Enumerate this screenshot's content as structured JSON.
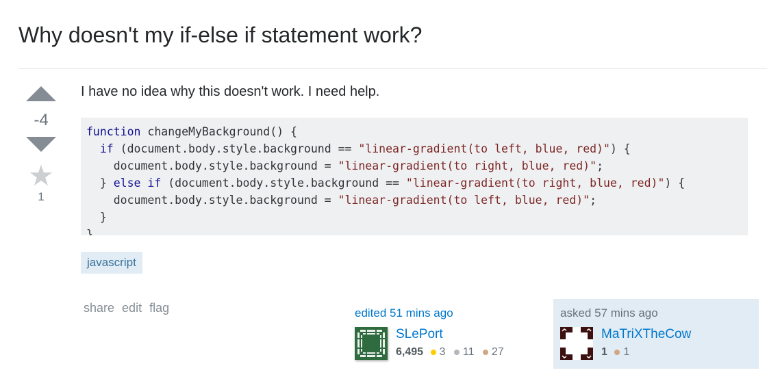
{
  "question": {
    "title": "Why doesn't my if-else if statement work?",
    "body_text": "I have no idea why this doesn't work. I need help.",
    "code_lines": [
      [
        {
          "t": "kw",
          "v": "function"
        },
        {
          "t": "p",
          "v": " changeMyBackground() {"
        }
      ],
      [
        {
          "t": "p",
          "v": "  "
        },
        {
          "t": "kw",
          "v": "if"
        },
        {
          "t": "p",
          "v": " (document.body.style.background == "
        },
        {
          "t": "str",
          "v": "\"linear-gradient(to left, blue, red)\""
        },
        {
          "t": "p",
          "v": ") {"
        }
      ],
      [
        {
          "t": "p",
          "v": "    document.body.style.background = "
        },
        {
          "t": "str",
          "v": "\"linear-gradient(to right, blue, red)\""
        },
        {
          "t": "p",
          "v": ";"
        }
      ],
      [
        {
          "t": "p",
          "v": "  } "
        },
        {
          "t": "kw",
          "v": "else if"
        },
        {
          "t": "p",
          "v": " (document.body.style.background == "
        },
        {
          "t": "str",
          "v": "\"linear-gradient(to right, blue, red)\""
        },
        {
          "t": "p",
          "v": ") {"
        }
      ],
      [
        {
          "t": "p",
          "v": "    document.body.style.background = "
        },
        {
          "t": "str",
          "v": "\"linear-gradient(to left, blue, red)\""
        },
        {
          "t": "p",
          "v": ";"
        }
      ],
      [
        {
          "t": "p",
          "v": "  }"
        }
      ],
      [
        {
          "t": "p",
          "v": "}"
        }
      ]
    ],
    "tags": [
      "javascript"
    ]
  },
  "votes": {
    "score": "-4",
    "favorites": "1",
    "icons": {
      "up": "upvote-arrow-icon",
      "down": "downvote-arrow-icon",
      "favorite": "star-icon"
    }
  },
  "post_menu": {
    "share": "share",
    "edit": "edit",
    "flag": "flag"
  },
  "editor": {
    "action": "edited 51 mins ago",
    "name": "SLePort",
    "reputation": "6,495",
    "gold": "3",
    "silver": "11",
    "bronze": "27"
  },
  "asker": {
    "action": "asked 57 mins ago",
    "name": "MaTriXTheCow",
    "reputation": "1",
    "bronze": "1"
  },
  "colors": {
    "link": "#0077cc",
    "tag_bg": "#e1ecf4",
    "gold": "#ffcc01",
    "silver": "#b4b8bc",
    "bronze": "#d1a684"
  }
}
